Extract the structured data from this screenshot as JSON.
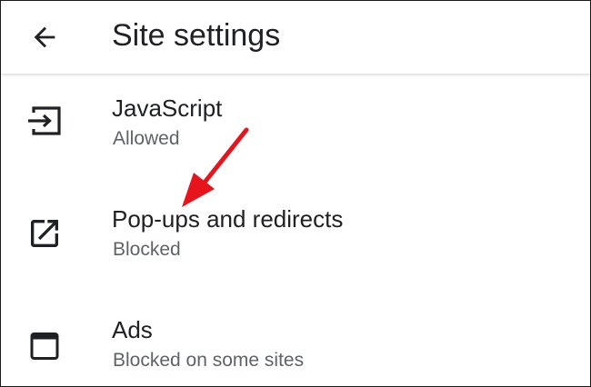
{
  "header": {
    "title": "Site settings",
    "back_icon": "arrow-back-icon"
  },
  "settings": [
    {
      "title": "JavaScript",
      "subtitle": "Allowed",
      "icon": "javascript-icon"
    },
    {
      "title": "Pop-ups and redirects",
      "subtitle": "Blocked",
      "icon": "open-in-new-icon"
    },
    {
      "title": "Ads",
      "subtitle": "Blocked on some sites",
      "icon": "web-asset-icon"
    }
  ],
  "colors": {
    "text_primary": "#202124",
    "text_secondary": "#5f6368",
    "annotation_arrow": "#e8141b"
  }
}
